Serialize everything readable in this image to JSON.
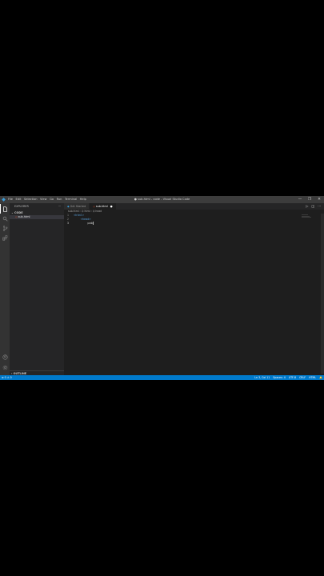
{
  "titlebar": {
    "menu": [
      "File",
      "Edit",
      "Selection",
      "View",
      "Go",
      "Run",
      "Terminal",
      "Help"
    ],
    "title": "● sub.html - code - Visual Studio Code",
    "controls": [
      "—",
      "❐",
      "✕"
    ]
  },
  "activitybar": {
    "icons": [
      "explorer-icon",
      "search-icon",
      "source-control-icon",
      "extensions-icon"
    ],
    "bottom_icons": [
      "account-icon",
      "settings-icon"
    ]
  },
  "sidebar": {
    "title": "EXPLORER",
    "more": "···",
    "section": "⌄ CODE",
    "files": [
      "sub.html"
    ],
    "outline": "› OUTLINE"
  },
  "editor": {
    "tabs": [
      {
        "label": "Get Started",
        "active": false
      },
      {
        "label": "sub.html",
        "active": true,
        "dirty_mark": "●"
      }
    ],
    "actions": [
      "▷",
      "◫",
      "···"
    ],
    "breadcrumb": "sub.html › ⌬ html › ⌬ head",
    "lines": [
      {
        "num": "1",
        "indent": "",
        "parts": [
          {
            "cls": "tag",
            "t": "<html>"
          }
        ]
      },
      {
        "num": "2",
        "indent": "    ",
        "parts": [
          {
            "cls": "tag",
            "t": "<head>"
          }
        ]
      },
      {
        "num": "3",
        "indent": "        ",
        "parts": [
          {
            "cls": "txt",
            "t": "pab"
          }
        ]
      }
    ]
  },
  "statusbar": {
    "left": "⊗ 0 ⚠ 0",
    "right": [
      "Ln 3, Col 11",
      "Spaces: 4",
      "UTF-8",
      "CRLF",
      "HTML",
      "🔔"
    ]
  }
}
